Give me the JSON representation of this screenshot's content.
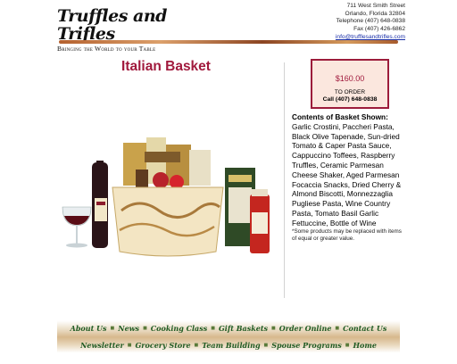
{
  "header": {
    "logo_text": "Truffles and Trifles",
    "tagline": "Bringing the World to your Table",
    "address_line1": "711 West Smith Street",
    "address_line2": "Orlando, Florida 32804",
    "telephone": "Telephone (407) 648-0838",
    "fax": "Fax (407) 426-6862",
    "email": "info@trufflesandtrifles.com"
  },
  "product": {
    "title": "Italian Basket",
    "price": "$160.00",
    "order_label": "TO ORDER",
    "order_call": "Call (407) 648-0838",
    "contents_heading": "Contents of Basket Shown:",
    "contents": "Garlic Crostini, Paccheri Pasta, Black Olive Tapenade, Sun-dried Tomato & Caper Pasta Sauce, Cappuccino Toffees, Raspberry Truffles, Ceramic Parmesan Cheese Shaker, Aged Parmesan Focaccia Snacks, Dried Cherry & Almond Biscotti, Monnezzaglia Pugliese Pasta, Wine Country Pasta, Tomato Basil Garlic Fettuccine, Bottle of Wine",
    "note": "*Some products may be replaced with items of equal or greater value."
  },
  "nav": {
    "row1": [
      "About Us",
      "News",
      "Cooking Class",
      "Gift Baskets",
      "Order Online",
      "Contact Us"
    ],
    "row2": [
      "Newsletter",
      "Grocery Store",
      "Team Building",
      "Spouse Programs",
      "Home"
    ]
  },
  "colors": {
    "title": "#a11a3d",
    "price_border": "#9c1c3b",
    "price_bg": "#fbe7de",
    "nav_text": "#1f5a22",
    "link": "#1a2fa8"
  }
}
